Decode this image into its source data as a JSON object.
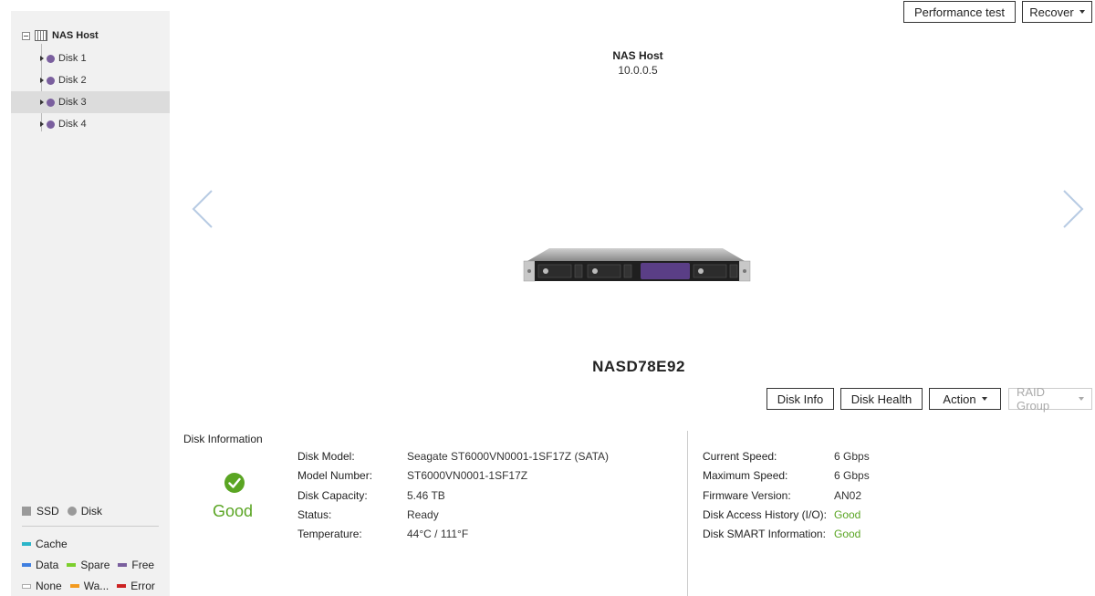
{
  "sidebar": {
    "root_label": "NAS Host",
    "items": [
      {
        "label": "Disk 1",
        "selected": false
      },
      {
        "label": "Disk 2",
        "selected": false
      },
      {
        "label": "Disk 3",
        "selected": true
      },
      {
        "label": "Disk 4",
        "selected": false
      }
    ],
    "legend": {
      "ssd": "SSD",
      "disk": "Disk",
      "cache": "Cache",
      "data": "Data",
      "spare": "Spare",
      "free": "Free",
      "none": "None",
      "warning": "Wa...",
      "error": "Error"
    }
  },
  "toolbar": {
    "performance_test": "Performance test",
    "recover": "Recover"
  },
  "host": {
    "name": "NAS Host",
    "ip": "10.0.0.5"
  },
  "device_name": "NASD78E92",
  "actions": {
    "disk_info": "Disk Info",
    "disk_health": "Disk Health",
    "action": "Action",
    "raid_group": "RAID Group"
  },
  "disk_information": {
    "title": "Disk Information",
    "status": "Good",
    "left": [
      {
        "label": "Disk Model:",
        "value": "Seagate ST6000VN0001-1SF17Z (SATA)"
      },
      {
        "label": "Model Number:",
        "value": "ST6000VN0001-1SF17Z"
      },
      {
        "label": "Disk Capacity:",
        "value": "5.46 TB"
      },
      {
        "label": "Status:",
        "value": "Ready"
      },
      {
        "label": "Temperature:",
        "value": "44°C / 111°F"
      }
    ],
    "right": [
      {
        "label": "Current Speed:",
        "value": "6 Gbps"
      },
      {
        "label": "Maximum Speed:",
        "value": "6 Gbps"
      },
      {
        "label": "Firmware Version:",
        "value": "AN02"
      },
      {
        "label": "Disk Access History (I/O):",
        "value": "Good"
      },
      {
        "label": "Disk SMART Information:",
        "value": "Good"
      }
    ]
  },
  "colors": {
    "good": "#5aa523",
    "disk_dot": "#7a5f9e",
    "cache": "#2bb5c9",
    "data": "#3f7fe0",
    "spare": "#7ccf2d",
    "free": "#7a5f9e",
    "warning": "#f39a1e",
    "error": "#cc2222"
  }
}
